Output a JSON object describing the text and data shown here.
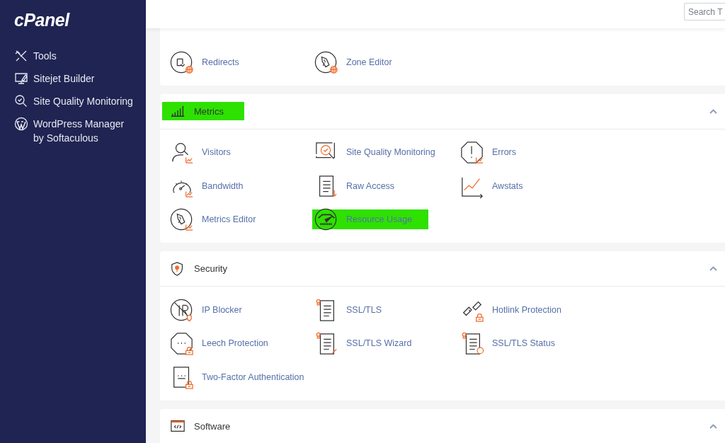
{
  "sidebar": {
    "logo": "cPanel",
    "items": [
      {
        "label": "Tools"
      },
      {
        "label": "Sitejet Builder"
      },
      {
        "label": "Site Quality Monitoring"
      },
      {
        "label": "WordPress Manager by Softaculous"
      }
    ]
  },
  "search": {
    "placeholder": "Search T"
  },
  "sections": [
    {
      "items": [
        {
          "label": "Redirects",
          "highlighted": false
        },
        {
          "label": "Zone Editor",
          "highlighted": false
        }
      ]
    },
    {
      "title": "Metrics",
      "highlighted": true,
      "expanded": true,
      "items": [
        {
          "label": "Visitors",
          "highlighted": false
        },
        {
          "label": "Site Quality Monitoring",
          "highlighted": false
        },
        {
          "label": "Errors",
          "highlighted": false
        },
        {
          "label": "Bandwidth",
          "highlighted": false
        },
        {
          "label": "Raw Access",
          "highlighted": false
        },
        {
          "label": "Awstats",
          "highlighted": false
        },
        {
          "label": "Metrics Editor",
          "highlighted": false
        },
        {
          "label": "Resource Usage",
          "highlighted": true
        }
      ]
    },
    {
      "title": "Security",
      "highlighted": false,
      "expanded": true,
      "items": [
        {
          "label": "IP Blocker",
          "highlighted": false
        },
        {
          "label": "SSL/TLS",
          "highlighted": false
        },
        {
          "label": "Hotlink Protection",
          "highlighted": false
        },
        {
          "label": "Leech Protection",
          "highlighted": false
        },
        {
          "label": "SSL/TLS Wizard",
          "highlighted": false
        },
        {
          "label": "SSL/TLS Status",
          "highlighted": false
        },
        {
          "label": "Two-Factor Authentication",
          "highlighted": false
        }
      ]
    },
    {
      "title": "Software",
      "highlighted": false,
      "expanded": true
    }
  ]
}
